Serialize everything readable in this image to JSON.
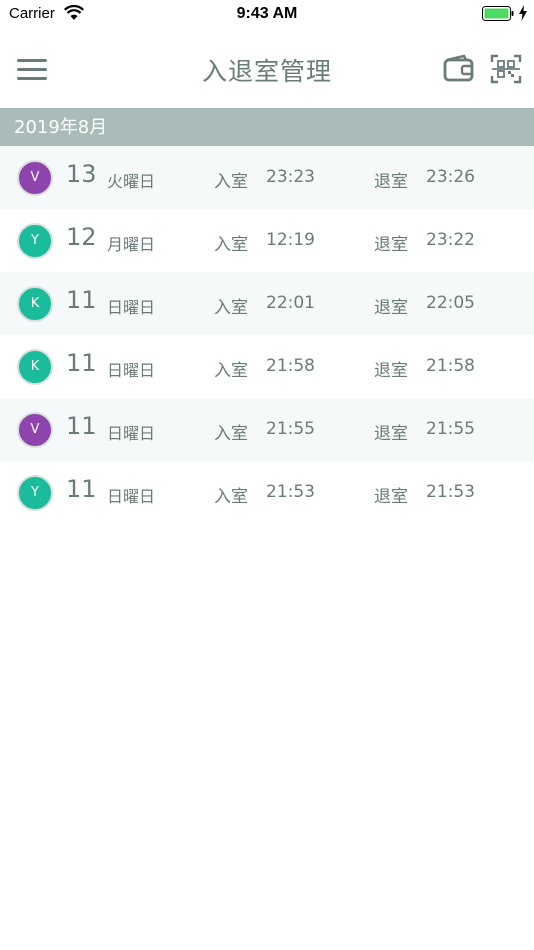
{
  "status_bar": {
    "carrier": "Carrier",
    "time": "9:43 AM",
    "battery_color": "#4cd964"
  },
  "nav": {
    "title": "入退室管理",
    "menu_icon": "hamburger-menu-icon",
    "wallet_icon": "wallet-icon",
    "scan_icon": "qr-scan-icon"
  },
  "section": {
    "header": "2019年8月",
    "header_color": "#a9bcb9"
  },
  "labels": {
    "in": "入室",
    "out": "退室"
  },
  "colors": {
    "purple": "#8e44ad",
    "teal": "#1abc9c",
    "text": "#6a7c79"
  },
  "entries": [
    {
      "initial": "V",
      "color": "#8e44ad",
      "day": "13",
      "weekday": "火曜日",
      "in_time": "23:23",
      "out_time": "23:26"
    },
    {
      "initial": "Y",
      "color": "#1abc9c",
      "day": "12",
      "weekday": "月曜日",
      "in_time": "12:19",
      "out_time": "23:22"
    },
    {
      "initial": "K",
      "color": "#1abc9c",
      "day": "11",
      "weekday": "日曜日",
      "in_time": "22:01",
      "out_time": "22:05"
    },
    {
      "initial": "K",
      "color": "#1abc9c",
      "day": "11",
      "weekday": "日曜日",
      "in_time": "21:58",
      "out_time": "21:58"
    },
    {
      "initial": "V",
      "color": "#8e44ad",
      "day": "11",
      "weekday": "日曜日",
      "in_time": "21:55",
      "out_time": "21:55"
    },
    {
      "initial": "Y",
      "color": "#1abc9c",
      "day": "11",
      "weekday": "日曜日",
      "in_time": "21:53",
      "out_time": "21:53"
    }
  ]
}
